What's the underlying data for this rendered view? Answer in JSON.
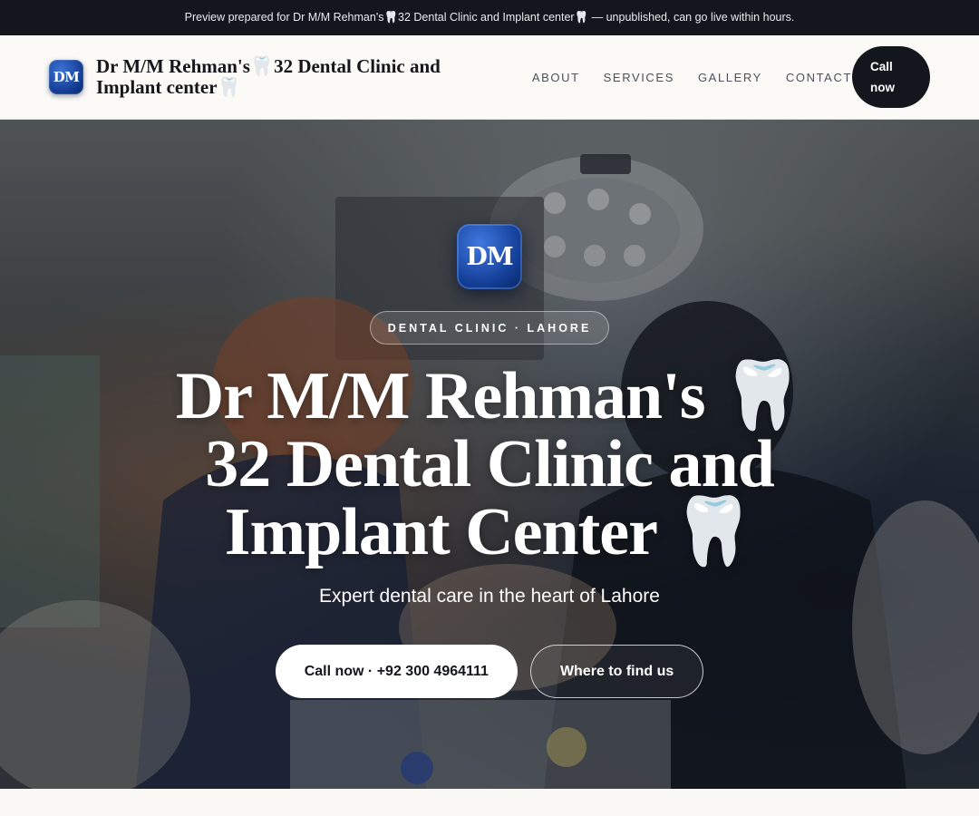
{
  "preview_bar": {
    "text": "Preview prepared for Dr M/M Rehman's🦷32 Dental Clinic and Implant center🦷 — unpublished, can go live within hours."
  },
  "header": {
    "logo_text": "DM",
    "brand_name": "Dr M/M Rehman's🦷32 Dental Clinic and Implant center🦷",
    "nav": [
      {
        "label": "ABOUT"
      },
      {
        "label": "SERVICES"
      },
      {
        "label": "GALLERY"
      },
      {
        "label": "CONTACT"
      }
    ],
    "call_label": "Call now"
  },
  "hero": {
    "logo_text": "DM",
    "kicker": "DENTAL CLINIC · LAHORE",
    "title": "Dr M/M Rehman's 🦷32 Dental Clinic and Implant Center 🦷",
    "subtitle": "Expert dental care in the heart of Lahore",
    "primary_cta": "Call now · +92 300 4964111",
    "secondary_cta": "Where to find us"
  }
}
